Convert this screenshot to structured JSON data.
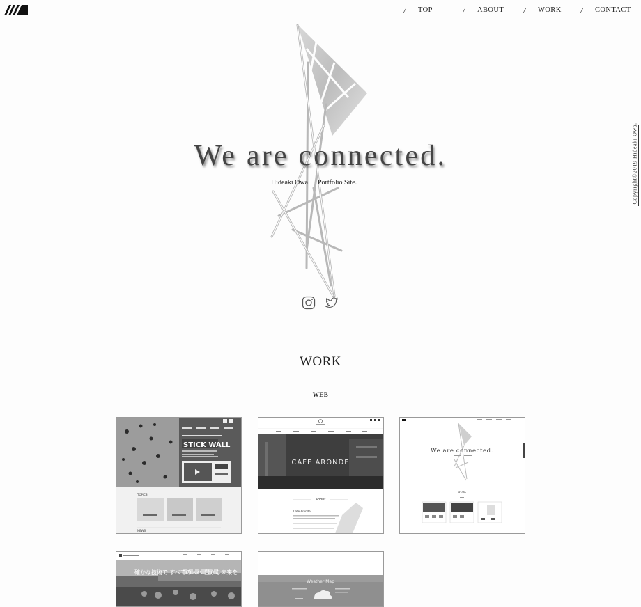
{
  "nav": {
    "items": [
      "TOP",
      "ABOUT",
      "WORK",
      "CONTACT"
    ]
  },
  "side": {
    "copyright": "Copyright©2019 Hideaki Owa."
  },
  "hero": {
    "title": "We are connected.",
    "subtitle_name": "Hideaki Owa",
    "subtitle_site": "Portfolio Site."
  },
  "work": {
    "heading": "WORK",
    "subheading": "WEB",
    "cards": [
      {
        "id": "stick-wall",
        "label": "STICK WALL",
        "topics": "TOPICS",
        "news": "NEWS"
      },
      {
        "id": "cafe-aronde",
        "label": "CAFE ARONDE",
        "about": "About",
        "brand": "Cafe Aronde"
      },
      {
        "id": "portfolio",
        "label": "We are connected.",
        "work": "WORK"
      },
      {
        "id": "tech",
        "label": "確かな技術で すべての人へ 豊かな未来を"
      },
      {
        "id": "weather",
        "label": "Weather Map"
      }
    ]
  }
}
